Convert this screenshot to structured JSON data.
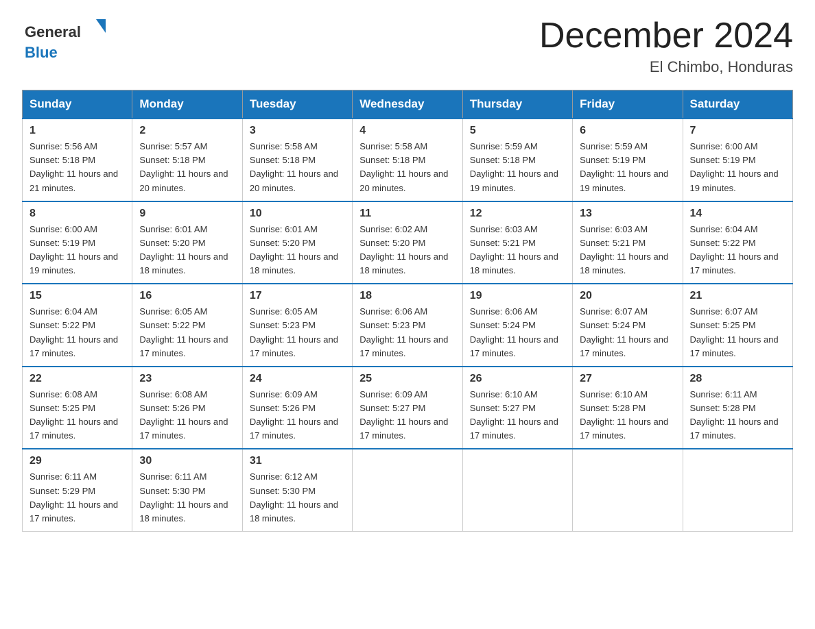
{
  "header": {
    "logo_line1": "General",
    "logo_line2": "Blue",
    "title": "December 2024",
    "subtitle": "El Chimbo, Honduras"
  },
  "weekdays": [
    "Sunday",
    "Monday",
    "Tuesday",
    "Wednesday",
    "Thursday",
    "Friday",
    "Saturday"
  ],
  "weeks": [
    [
      {
        "day": "1",
        "sunrise": "5:56 AM",
        "sunset": "5:18 PM",
        "daylight": "11 hours and 21 minutes."
      },
      {
        "day": "2",
        "sunrise": "5:57 AM",
        "sunset": "5:18 PM",
        "daylight": "11 hours and 20 minutes."
      },
      {
        "day": "3",
        "sunrise": "5:58 AM",
        "sunset": "5:18 PM",
        "daylight": "11 hours and 20 minutes."
      },
      {
        "day": "4",
        "sunrise": "5:58 AM",
        "sunset": "5:18 PM",
        "daylight": "11 hours and 20 minutes."
      },
      {
        "day": "5",
        "sunrise": "5:59 AM",
        "sunset": "5:18 PM",
        "daylight": "11 hours and 19 minutes."
      },
      {
        "day": "6",
        "sunrise": "5:59 AM",
        "sunset": "5:19 PM",
        "daylight": "11 hours and 19 minutes."
      },
      {
        "day": "7",
        "sunrise": "6:00 AM",
        "sunset": "5:19 PM",
        "daylight": "11 hours and 19 minutes."
      }
    ],
    [
      {
        "day": "8",
        "sunrise": "6:00 AM",
        "sunset": "5:19 PM",
        "daylight": "11 hours and 19 minutes."
      },
      {
        "day": "9",
        "sunrise": "6:01 AM",
        "sunset": "5:20 PM",
        "daylight": "11 hours and 18 minutes."
      },
      {
        "day": "10",
        "sunrise": "6:01 AM",
        "sunset": "5:20 PM",
        "daylight": "11 hours and 18 minutes."
      },
      {
        "day": "11",
        "sunrise": "6:02 AM",
        "sunset": "5:20 PM",
        "daylight": "11 hours and 18 minutes."
      },
      {
        "day": "12",
        "sunrise": "6:03 AM",
        "sunset": "5:21 PM",
        "daylight": "11 hours and 18 minutes."
      },
      {
        "day": "13",
        "sunrise": "6:03 AM",
        "sunset": "5:21 PM",
        "daylight": "11 hours and 18 minutes."
      },
      {
        "day": "14",
        "sunrise": "6:04 AM",
        "sunset": "5:22 PM",
        "daylight": "11 hours and 17 minutes."
      }
    ],
    [
      {
        "day": "15",
        "sunrise": "6:04 AM",
        "sunset": "5:22 PM",
        "daylight": "11 hours and 17 minutes."
      },
      {
        "day": "16",
        "sunrise": "6:05 AM",
        "sunset": "5:22 PM",
        "daylight": "11 hours and 17 minutes."
      },
      {
        "day": "17",
        "sunrise": "6:05 AM",
        "sunset": "5:23 PM",
        "daylight": "11 hours and 17 minutes."
      },
      {
        "day": "18",
        "sunrise": "6:06 AM",
        "sunset": "5:23 PM",
        "daylight": "11 hours and 17 minutes."
      },
      {
        "day": "19",
        "sunrise": "6:06 AM",
        "sunset": "5:24 PM",
        "daylight": "11 hours and 17 minutes."
      },
      {
        "day": "20",
        "sunrise": "6:07 AM",
        "sunset": "5:24 PM",
        "daylight": "11 hours and 17 minutes."
      },
      {
        "day": "21",
        "sunrise": "6:07 AM",
        "sunset": "5:25 PM",
        "daylight": "11 hours and 17 minutes."
      }
    ],
    [
      {
        "day": "22",
        "sunrise": "6:08 AM",
        "sunset": "5:25 PM",
        "daylight": "11 hours and 17 minutes."
      },
      {
        "day": "23",
        "sunrise": "6:08 AM",
        "sunset": "5:26 PM",
        "daylight": "11 hours and 17 minutes."
      },
      {
        "day": "24",
        "sunrise": "6:09 AM",
        "sunset": "5:26 PM",
        "daylight": "11 hours and 17 minutes."
      },
      {
        "day": "25",
        "sunrise": "6:09 AM",
        "sunset": "5:27 PM",
        "daylight": "11 hours and 17 minutes."
      },
      {
        "day": "26",
        "sunrise": "6:10 AM",
        "sunset": "5:27 PM",
        "daylight": "11 hours and 17 minutes."
      },
      {
        "day": "27",
        "sunrise": "6:10 AM",
        "sunset": "5:28 PM",
        "daylight": "11 hours and 17 minutes."
      },
      {
        "day": "28",
        "sunrise": "6:11 AM",
        "sunset": "5:28 PM",
        "daylight": "11 hours and 17 minutes."
      }
    ],
    [
      {
        "day": "29",
        "sunrise": "6:11 AM",
        "sunset": "5:29 PM",
        "daylight": "11 hours and 17 minutes."
      },
      {
        "day": "30",
        "sunrise": "6:11 AM",
        "sunset": "5:30 PM",
        "daylight": "11 hours and 18 minutes."
      },
      {
        "day": "31",
        "sunrise": "6:12 AM",
        "sunset": "5:30 PM",
        "daylight": "11 hours and 18 minutes."
      },
      null,
      null,
      null,
      null
    ]
  ],
  "labels": {
    "sunrise": "Sunrise:",
    "sunset": "Sunset:",
    "daylight": "Daylight:"
  }
}
